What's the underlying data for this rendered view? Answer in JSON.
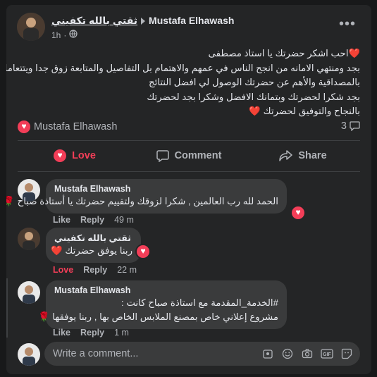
{
  "post": {
    "page_name": "ثقتي بالله تكفيني",
    "author": "Mustafa Elhawash",
    "time": "1h",
    "lines": [
      "❤️احب اشكر حضرتك يا استاذ مصطفى",
      "بجد ومنتهي الامانه من انجح الناس في عمهم والاهتمام بل التفاصيل والمتابعة زوق جدا ويتتعامل",
      "بالمصداقية والأهم عن حضرتك الوصول لي افضل النتائج",
      "بجد شكرا لحضرتك وبتمانك الافضل وشكرا بجد لحضرتك",
      "بالنجاح والتوفيق لحضرتك ❤️"
    ],
    "reaction_name": "Mustafa Elhawash",
    "comment_count": "3"
  },
  "actions": {
    "love": "Love",
    "comment": "Comment",
    "share": "Share"
  },
  "comments": [
    {
      "name": "Mustafa Elhawash",
      "text": "الحمد لله رب العالمين , شكرا لزوقك ولتقييم حضرتك يا أستاذة صباح 🌹",
      "like": "Like",
      "reply": "Reply",
      "time": "49 m"
    },
    {
      "name": "ثقتي بالله تكفيني",
      "text": "ربنا يوفق حضرتك ❤️",
      "like": "Love",
      "reply": "Reply",
      "time": "22 m"
    },
    {
      "name": "Mustafa Elhawash",
      "text1": "#الخدمة_المقدمة مع استاذة صباح كانت :",
      "text2": "مشروع إعلاني خاص بمصنع الملابس الخاص بها , ربنا يوفقها 🌹",
      "like": "Like",
      "reply": "Reply",
      "time": "1 m"
    }
  ],
  "composer": {
    "placeholder": "Write a comment..."
  },
  "colors": {
    "love": "#f33e58",
    "card": "#242526",
    "bubble": "#3a3b3c"
  }
}
